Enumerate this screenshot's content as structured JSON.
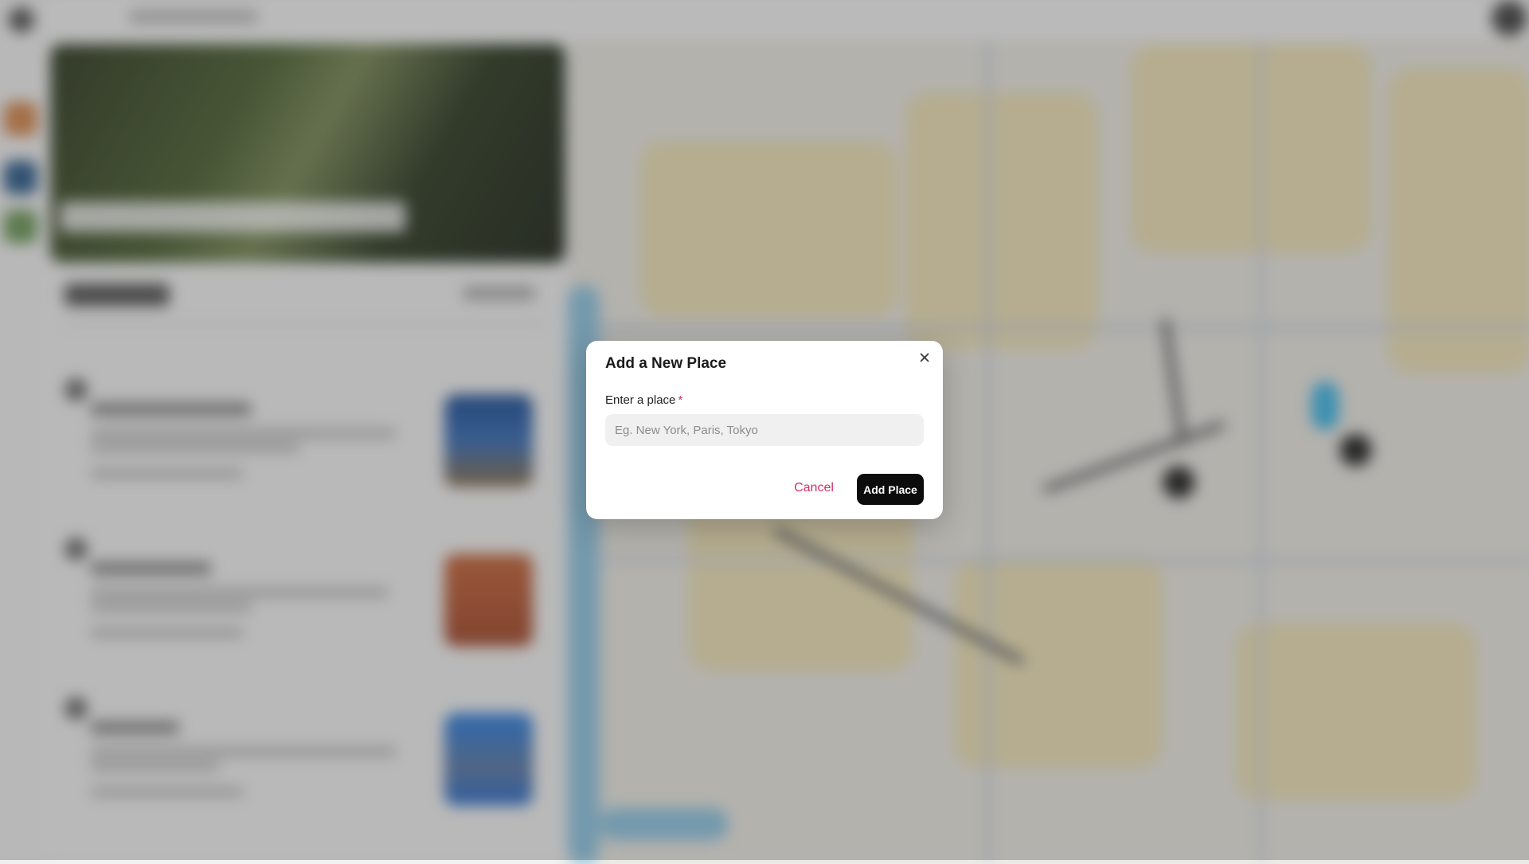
{
  "dialog": {
    "title": "Add a New Place",
    "field_label": "Enter a place",
    "required_marker": "*",
    "input_value": "",
    "input_placeholder": "Eg. New York, Paris, Tokyo",
    "cancel_label": "Cancel",
    "submit_label": "Add Place",
    "close_icon": "close-icon"
  },
  "colors": {
    "accent_pink": "#d62c6a",
    "primary_button": "#0c0c0c",
    "overlay": "rgba(60,60,60,0.32)"
  }
}
